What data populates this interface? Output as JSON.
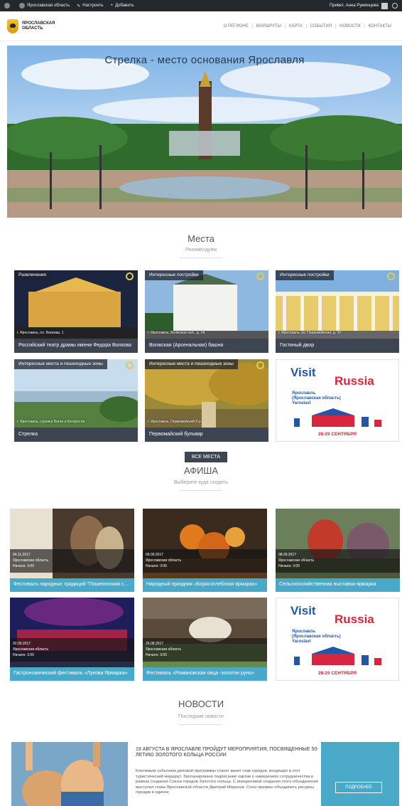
{
  "adminbar": {
    "site": "Ярославская область",
    "customize": "Настроить",
    "add": "Добавить",
    "greeting": "Привет, Анна Румянцева"
  },
  "header": {
    "logo_text": "ЯРОСЛАВСКАЯ ОБЛАСТЬ",
    "nav": [
      "О РЕГИОНЕ",
      "МАРШРУТЫ",
      "КАРТА",
      "СОБЫТИЯ",
      "НОВОСТИ",
      "КОНТАКТЫ"
    ]
  },
  "hero": {
    "title": "Стрелка - место основания Ярославля"
  },
  "places": {
    "title": "Места",
    "subtitle": "Рекомендуем",
    "cards": [
      {
        "category": "Развлечения",
        "address": "г. Ярославль, пл. Волкова, 1",
        "name": "Российский театр драмы имени Федора Волкова"
      },
      {
        "category": "Интересные постройки",
        "address": "г. Ярославль, Волжская наб., д. 2А",
        "name": "Волжская (Арсенальная) башня"
      },
      {
        "category": "Интересные постройки",
        "address": "г. Ярославль, ул. Первомайская, д. 10",
        "name": "Гостиный двор"
      },
      {
        "category": "Интересные места и пешеходные зоны",
        "address": "г. Ярославль, стрелка Волги и Которосли",
        "name": "Стрелка"
      },
      {
        "category": "Интересные места и пешеходные зоны",
        "address": "г. Ярославль, Первомайский б-р",
        "name": "Первомайский бульвар"
      }
    ],
    "all_button": "ВСЕ МЕСТА"
  },
  "promo": {
    "visit": "Visit",
    "russia": "Russia",
    "region": "Ярославль (Ярославская область) Yaroslavl",
    "dates": "28-29 СЕНТЯБРЯ"
  },
  "afisha": {
    "title": "АФИША",
    "subtitle": "Выберите куда сходить",
    "events": [
      {
        "date": "04.11.2017",
        "place": "Ярославская область",
        "time": "Начало: 3:00",
        "name": "Фестиваль народных традиций \"Пошехонская старина\""
      },
      {
        "date": "09.09.2017",
        "place": "Ярославская область",
        "time": "Начало: 3:00",
        "name": "Народный праздник «Борисоглебская ярмарка»"
      },
      {
        "date": "08.09.2017",
        "place": "Ярославская область",
        "time": "Начало: 3:00",
        "name": "Сельскохозяйственная выставка-ярмарка"
      },
      {
        "date": "02.09.2017",
        "place": "Ярославская область",
        "time": "Начало: 3:00",
        "name": "Гастрономический фестиваль «Лукова Ярмарка»"
      },
      {
        "date": "26.08.2017",
        "place": "Ярославская область",
        "time": "Начало: 3:00",
        "name": "Фестиваль «Романовская овца -золотое руно»"
      }
    ]
  },
  "news": {
    "title": "НОВОСТИ",
    "subtitle": "Последние новости",
    "headline": "19 АВГУСТА В ЯРОСЛАВЛЕ ПРОЙДУТ МЕРОПРИЯТИЯ, ПОСВЯЩЕННЫЕ 50-ЛЕТИЮ ЗОЛОТОГО КОЛЬЦА РОССИИ",
    "body": "Ключевым событием деловой программы станет визит глав городов, входящих в этот туристический маршрут. Запланировано подписание хартии о намерениях сотрудничества в рамках создания Союза городов Золотого кольца. С инициативой создания этого объединения выступил глава Ярославской области Дмитрий Миронов. Союз призван объединить ресурсы городов в единое",
    "more": "ПОДРОБНЕЕ"
  }
}
